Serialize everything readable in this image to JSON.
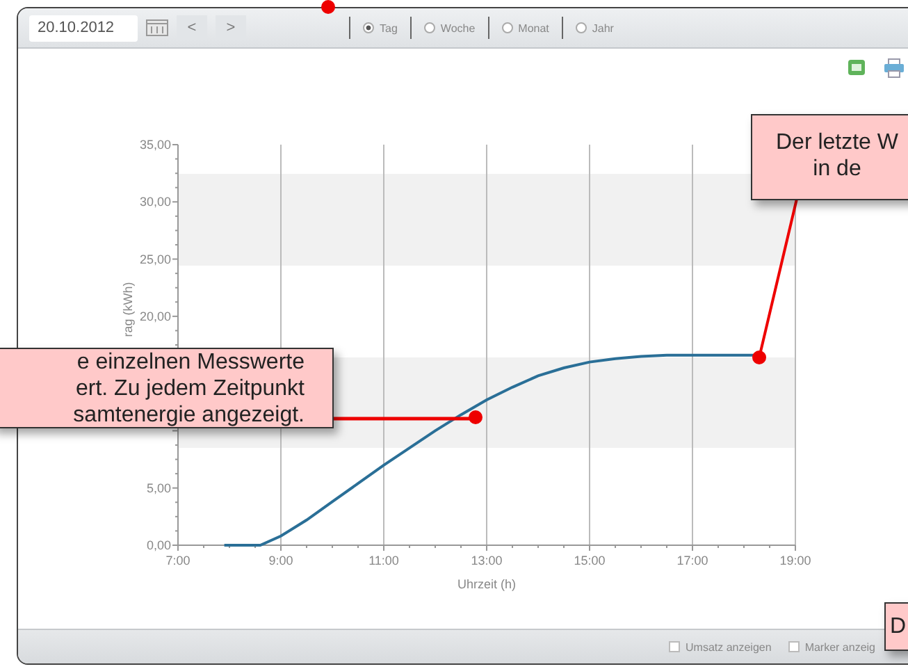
{
  "toolbar": {
    "date": "20.10.2012",
    "prev": "<",
    "next": ">",
    "periods": [
      {
        "label": "Tag",
        "selected": true
      },
      {
        "label": "Woche",
        "selected": false
      },
      {
        "label": "Monat",
        "selected": false
      },
      {
        "label": "Jahr",
        "selected": false
      }
    ]
  },
  "chart": {
    "chart_data": {
      "type": "line",
      "xlabel": "Uhrzeit (h)",
      "ylabel": "rag (kWh)",
      "x": [
        7.9,
        8.6,
        9,
        9.5,
        10,
        10.5,
        11,
        11.5,
        12,
        12.5,
        13,
        13.5,
        14,
        14.5,
        15,
        15.5,
        16,
        16.5,
        17,
        17.5,
        18.2
      ],
      "grid": true,
      "series": [
        {
          "color": "#2a6f97",
          "values": [
            0,
            0,
            0.8,
            2.2,
            3.8,
            5.4,
            7,
            8.5,
            10,
            11.4,
            12.7,
            13.8,
            14.8,
            15.5,
            16,
            16.3,
            16.5,
            16.6,
            16.6,
            16.6,
            16.6
          ]
        }
      ],
      "xlim": [
        7,
        19
      ],
      "ylim": [
        0,
        35
      ],
      "xticks": [
        {
          "value": 7,
          "label": "7:00"
        },
        {
          "value": 9,
          "label": "9:00"
        },
        {
          "value": 11,
          "label": "11:00"
        },
        {
          "value": 13,
          "label": "13:00"
        },
        {
          "value": 15,
          "label": "15:00"
        },
        {
          "value": 17,
          "label": "17:00"
        },
        {
          "value": 19,
          "label": "19:00"
        }
      ],
      "yticks": [
        {
          "value": 0,
          "label": "0,00"
        },
        {
          "value": 5,
          "label": "5,00"
        },
        {
          "value": 20,
          "label": "20,00"
        },
        {
          "value": 25,
          "label": "25,00"
        },
        {
          "value": 30,
          "label": "30,00"
        },
        {
          "value": 35,
          "label": "35,00"
        }
      ]
    }
  },
  "footer": {
    "options": [
      {
        "label": "Umsatz anzeigen",
        "checked": false
      },
      {
        "label": "Marker anzeig",
        "checked": false
      }
    ]
  },
  "callouts": [
    {
      "lines": [
        "Der letzte W",
        "in de"
      ]
    },
    {
      "lines": [
        "e einzelnen Messwerte",
        "ert. Zu jedem Zeitpunkt",
        "samtenergie angezeigt."
      ]
    },
    {
      "lines": [
        "D"
      ]
    }
  ]
}
